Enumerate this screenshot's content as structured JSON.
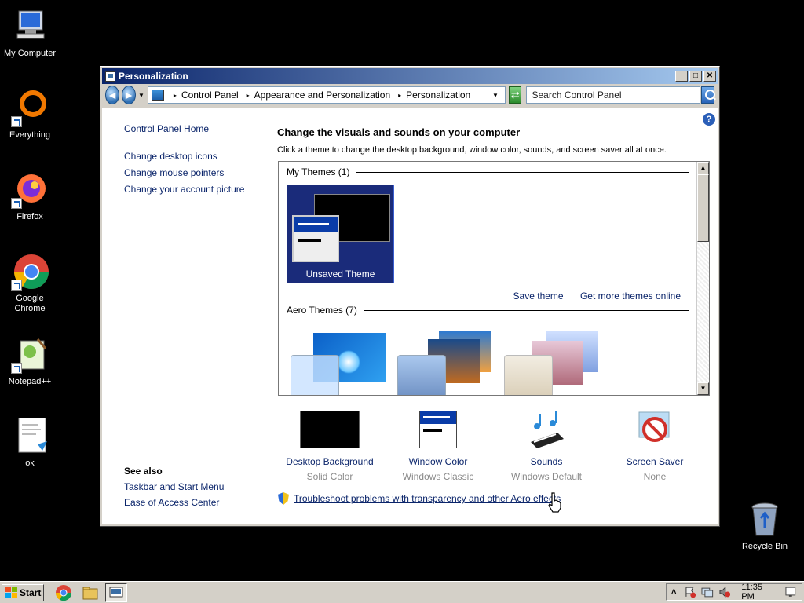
{
  "desktop": {
    "icons": [
      {
        "label": "My Computer"
      },
      {
        "label": "Everything"
      },
      {
        "label": "Firefox"
      },
      {
        "label": "Google Chrome"
      },
      {
        "label": "Notepad++"
      },
      {
        "label": "ok"
      },
      {
        "label": "Recycle Bin"
      }
    ]
  },
  "window": {
    "title": "Personalization",
    "buttons": {
      "minimize": "_",
      "maximize": "□",
      "close": "✕"
    },
    "nav": {
      "back": "◄",
      "forward": "►",
      "dropdown": "▼"
    },
    "address": {
      "crumbs": [
        "Control Panel",
        "Appearance and Personalization",
        "Personalization"
      ],
      "separator": "▸",
      "dropdown": "▼"
    },
    "refresh": "⇄",
    "search_placeholder": "Search Control Panel",
    "help": "?"
  },
  "leftnav": {
    "home": "Control Panel Home",
    "links": [
      "Change desktop icons",
      "Change mouse pointers",
      "Change your account picture"
    ]
  },
  "seealso": {
    "heading": "See also",
    "links": [
      "Taskbar and Start Menu",
      "Ease of Access Center"
    ]
  },
  "main": {
    "heading": "Change the visuals and sounds on your computer",
    "description": "Click a theme to change the desktop background, window color, sounds, and screen saver all at once."
  },
  "themes": {
    "my_themes_header": "My Themes (1)",
    "unsaved_label": "Unsaved Theme",
    "save_theme": "Save theme",
    "get_more": "Get more themes online",
    "aero_header": "Aero Themes (7)",
    "scroll_up": "▲",
    "scroll_down": "▼"
  },
  "bottom": [
    {
      "title": "Desktop Background",
      "sub": "Solid Color"
    },
    {
      "title": "Window Color",
      "sub": "Windows Classic"
    },
    {
      "title": "Sounds",
      "sub": "Windows Default"
    },
    {
      "title": "Screen Saver",
      "sub": "None"
    }
  ],
  "troubleshoot": "Troubleshoot problems with transparency and other Aero effects",
  "taskbar": {
    "start": "Start",
    "tray_expand": "˄",
    "clock": "11:35 PM"
  }
}
